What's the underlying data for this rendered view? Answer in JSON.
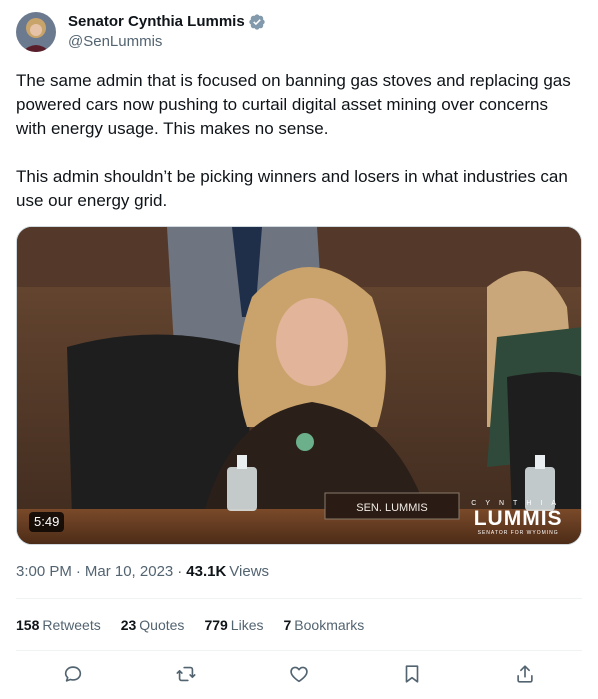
{
  "author": {
    "display_name": "Senator Cynthia Lummis",
    "handle": "@SenLummis",
    "verified_icon": "verified-badge-icon",
    "avatar_icon": "avatar"
  },
  "tweet": {
    "paragraph_1": "The same admin that is focused on banning gas stoves and replacing gas powered cars now pushing to curtail digital asset mining over concerns with energy usage. This makes no sense.",
    "paragraph_2": "This admin shouldn’t be picking winners and losers in what industries can use our energy grid."
  },
  "media": {
    "duration": "5:49",
    "nameplate": "SEN. LUMMIS",
    "watermark_top": "CYNTHIA",
    "watermark_main": "LUMMIS",
    "watermark_sub": "SENATOR FOR WYOMING"
  },
  "meta": {
    "time": "3:00 PM",
    "separator": "·",
    "date": "Mar 10, 2023",
    "views_count": "43.1K",
    "views_label": "Views"
  },
  "stats": {
    "retweets_count": "158",
    "retweets_label": "Retweets",
    "quotes_count": "23",
    "quotes_label": "Quotes",
    "likes_count": "779",
    "likes_label": "Likes",
    "bookmarks_count": "7",
    "bookmarks_label": "Bookmarks"
  },
  "actions": [
    "reply-icon",
    "retweet-icon",
    "like-icon",
    "bookmark-icon",
    "share-icon"
  ],
  "colors": {
    "text_primary": "#0f1419",
    "text_secondary": "#536471",
    "verified": "#829aab",
    "divider": "#eff3f4"
  }
}
